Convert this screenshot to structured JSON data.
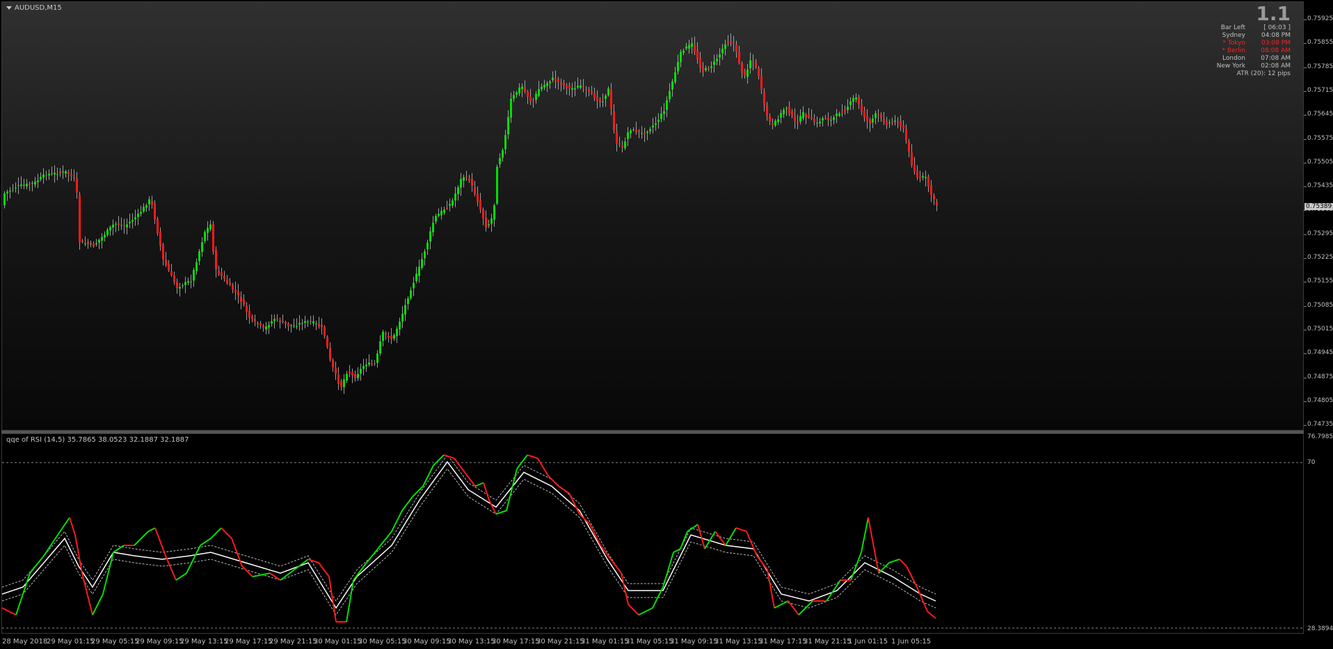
{
  "chart": {
    "symbol": "AUDUSD,M15",
    "current_price": "0.75389",
    "price_axis": [
      "0.75925",
      "0.75855",
      "0.75785",
      "0.75715",
      "0.75645",
      "0.75575",
      "0.75505",
      "0.75435",
      "0.75365",
      "0.75295",
      "0.75225",
      "0.75155",
      "0.75085",
      "0.75015",
      "0.74945",
      "0.74875",
      "0.74805",
      "0.74735"
    ],
    "time_axis": [
      "28 May 2018",
      "29 May 01:15",
      "29 May 05:15",
      "29 May 09:15",
      "29 May 13:15",
      "29 May 17:15",
      "29 May 21:15",
      "30 May 01:15",
      "30 May 05:15",
      "30 May 09:15",
      "30 May 13:15",
      "30 May 17:15",
      "30 May 21:15",
      "31 May 01:15",
      "31 May 05:15",
      "31 May 09:15",
      "31 May 13:15",
      "31 May 17:15",
      "31 May 21:15",
      "1 Jun 01:15",
      "1 Jun 05:15"
    ],
    "colors": {
      "bull": "#00e000",
      "bear": "#ff1a1a",
      "wick": "#c0c0c0"
    }
  },
  "info_panel": {
    "version": "1.1",
    "rows": [
      {
        "label": "Bar Left",
        "value": "[ 06:03 ]",
        "color": "gray"
      },
      {
        "label": "Sydney",
        "value": "04:08 PM",
        "color": "gray"
      },
      {
        "label": "* Tokyo",
        "value": "03:08 PM",
        "color": "red"
      },
      {
        "label": "* Berlin",
        "value": "08:08 AM",
        "color": "red"
      },
      {
        "label": "London",
        "value": "07:08 AM",
        "color": "gray"
      },
      {
        "label": "New York",
        "value": "02:08 AM",
        "color": "gray"
      }
    ],
    "atr": "ATR (20): 12 pips"
  },
  "indicator": {
    "title": "qqe of RSI (14,5) 35.7865 38.0523 32.1887 32.1887",
    "axis_max": "76.7985",
    "axis_min": "28.3894",
    "level_high": "70",
    "level_low": "30",
    "colors": {
      "rsi_up": "#00e000",
      "rsi_down": "#ff1a1a",
      "signal": "#ffffff",
      "band": "#bbbbbb"
    }
  }
}
